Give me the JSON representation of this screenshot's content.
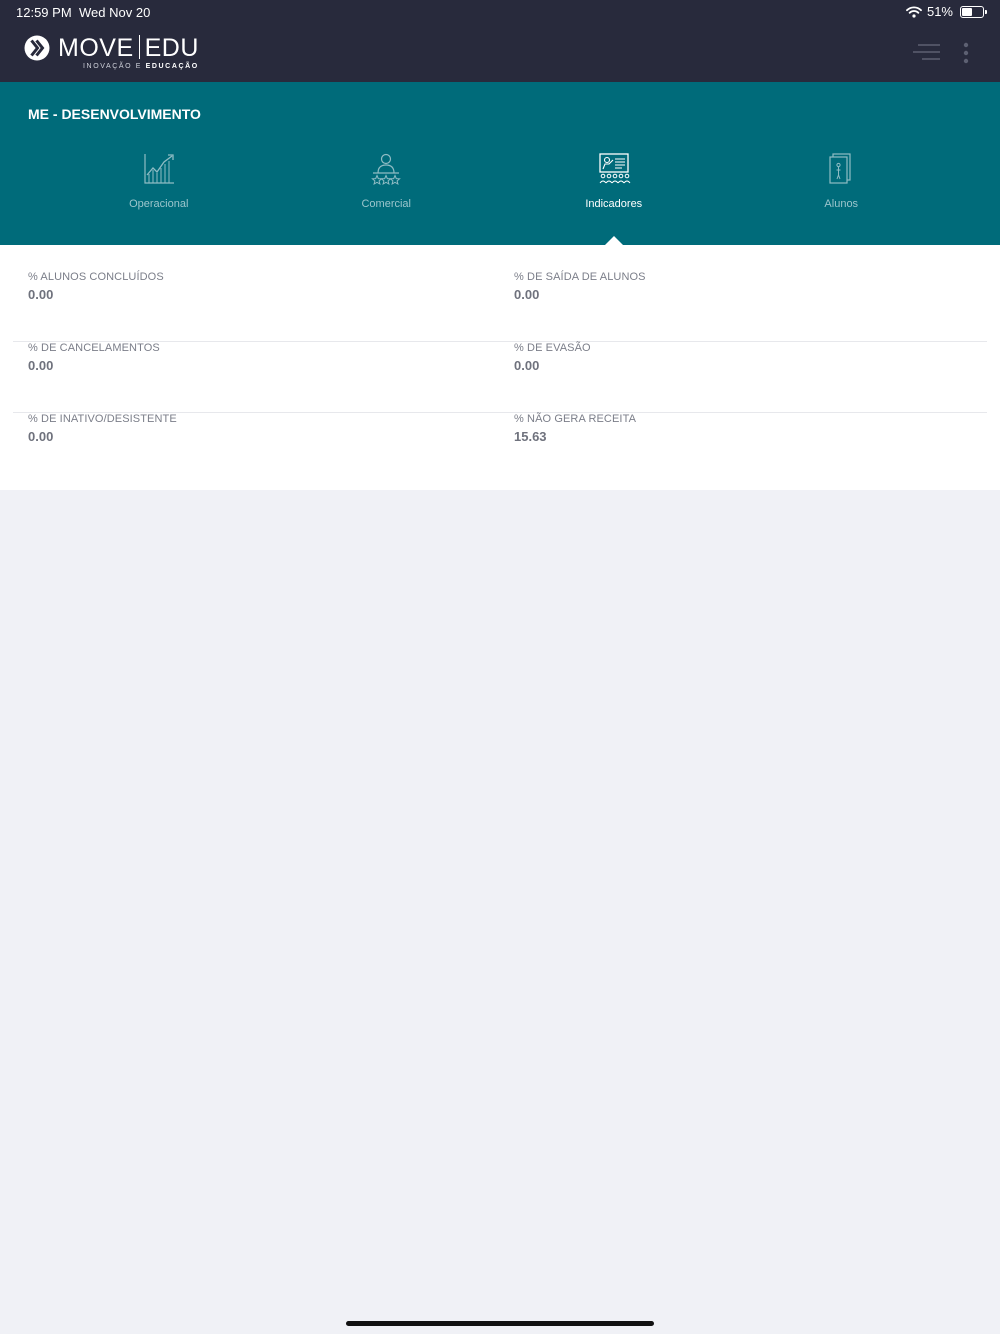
{
  "status_bar": {
    "time": "12:59 PM",
    "date": "Wed Nov 20",
    "battery": "51%",
    "battery_level": 0.51
  },
  "header": {
    "logo_text_left": "MOVE",
    "logo_text_right": "EDU",
    "logo_tagline_part1": "INOVAÇÃO E ",
    "logo_tagline_part2": "EDUCAÇÃO"
  },
  "company_title": "ME - DESENVOLVIMENTO",
  "tabs": [
    {
      "label": "Operacional",
      "icon": "chart-growth-icon",
      "active": false
    },
    {
      "label": "Comercial",
      "icon": "person-rating-icon",
      "active": false
    },
    {
      "label": "Indicadores",
      "icon": "presentation-board-icon",
      "active": true
    },
    {
      "label": "Alunos",
      "icon": "student-book-icon",
      "active": false
    }
  ],
  "metrics": [
    [
      {
        "label": "% ALUNOS CONCLUÍDOS",
        "value": "0.00"
      },
      {
        "label": "% DE SAÍDA DE ALUNOS",
        "value": "0.00"
      }
    ],
    [
      {
        "label": "% DE CANCELAMENTOS",
        "value": "0.00"
      },
      {
        "label": "% DE EVASÃO",
        "value": "0.00"
      }
    ],
    [
      {
        "label": "% DE INATIVO/DESISTENTE",
        "value": "0.00"
      },
      {
        "label": "% NÃO GERA RECEITA",
        "value": "15.63"
      }
    ]
  ],
  "colors": {
    "header_bg": "#282a3c",
    "accent_teal": "#006b7a",
    "page_bg": "#f0f1f6"
  }
}
